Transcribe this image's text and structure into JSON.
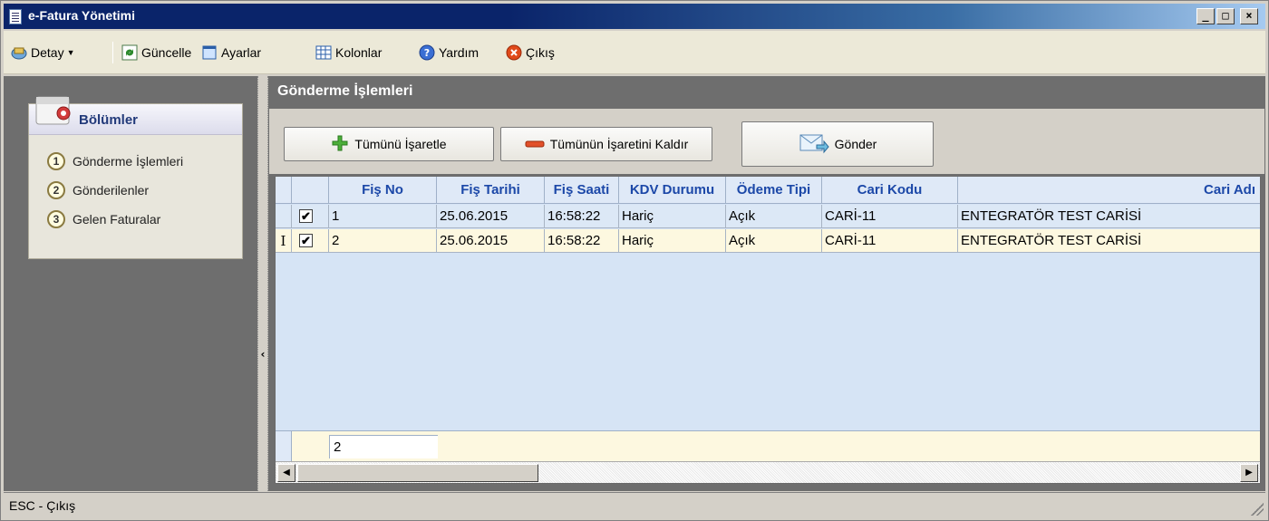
{
  "window": {
    "title": "e-Fatura Yönetimi",
    "minimize": "_",
    "maximize": "□",
    "close": "×"
  },
  "toolbar": {
    "detay": "Detay",
    "guncelle": "Güncelle",
    "ayarlar": "Ayarlar",
    "kolonlar": "Kolonlar",
    "yardim": "Yardım",
    "cikis": "Çıkış"
  },
  "sidebar": {
    "title": "Bölümler",
    "items": [
      {
        "num": "1",
        "label": "Gönderme İşlemleri"
      },
      {
        "num": "2",
        "label": "Gönderilenler"
      },
      {
        "num": "3",
        "label": "Gelen Faturalar"
      }
    ]
  },
  "main": {
    "title": "Gönderme İşlemleri",
    "buttons": {
      "select_all": "Tümünü İşaretle",
      "deselect_all": "Tümünün İşaretini Kaldır",
      "send": "Gönder"
    }
  },
  "grid": {
    "columns": [
      "Fiş No",
      "Fiş Tarihi",
      "Fiş Saati",
      "KDV Durumu",
      "Ödeme Tipi",
      "Cari Kodu",
      "Cari Adı"
    ],
    "rows": [
      {
        "indicator": "",
        "checked": "✔",
        "fis_no": "1",
        "fis_tarihi": "25.06.2015",
        "fis_saati": "16:58:22",
        "kdv": "Hariç",
        "odeme": "Açık",
        "cari_kodu": "CARİ-11",
        "cari_adi": "ENTEGRATÖR TEST CARİSİ"
      },
      {
        "indicator": "I",
        "checked": "✔",
        "fis_no": "2",
        "fis_tarihi": "25.06.2015",
        "fis_saati": "16:58:22",
        "kdv": "Hariç",
        "odeme": "Açık",
        "cari_kodu": "CARİ-11",
        "cari_adi": "ENTEGRATÖR TEST CARİSİ"
      }
    ],
    "footer_count": "2"
  },
  "status": {
    "text": "ESC - Çıkış"
  },
  "colors": {
    "header_text": "#1c48a8",
    "row_selected": "#fdf8e0",
    "grid_bg": "#d6e4f5",
    "panel_bg": "#6e6e6e"
  }
}
